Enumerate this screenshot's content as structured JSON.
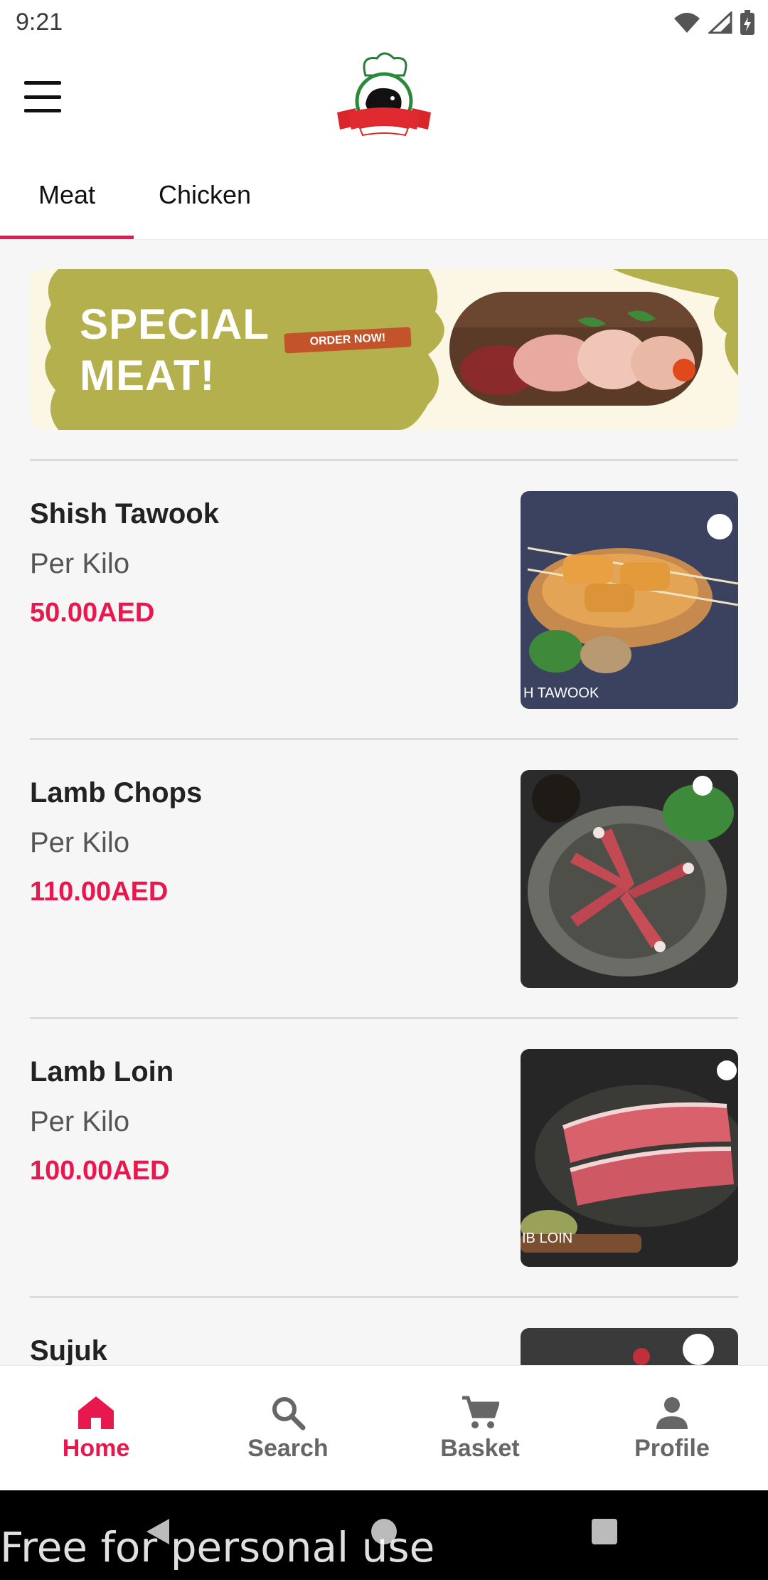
{
  "status_bar": {
    "time": "9:21"
  },
  "tabs": [
    {
      "label": "Meat",
      "active": true
    },
    {
      "label": "Chicken",
      "active": false
    }
  ],
  "banner": {
    "title_line1": "SPECIAL",
    "title_line2": "MEAT!",
    "cta": "ORDER NOW!"
  },
  "products": [
    {
      "name": "Shish Tawook",
      "unit": "Per Kilo",
      "price": "50.00AED",
      "image_caption": "H TAWOOK"
    },
    {
      "name": "Lamb Chops",
      "unit": "Per Kilo",
      "price": "110.00AED",
      "image_caption": ""
    },
    {
      "name": "Lamb Loin",
      "unit": "Per Kilo",
      "price": "100.00AED",
      "image_caption": "IB LOIN"
    },
    {
      "name": "Sujuk"
    }
  ],
  "bottom_nav": [
    {
      "label": "Home",
      "icon": "home-icon",
      "active": true
    },
    {
      "label": "Search",
      "icon": "search-icon",
      "active": false
    },
    {
      "label": "Basket",
      "icon": "cart-icon",
      "active": false
    },
    {
      "label": "Profile",
      "icon": "person-icon",
      "active": false
    }
  ],
  "watermark": "Free for personal use",
  "colors": {
    "accent": "#e8174e",
    "banner_olive": "#b5b04e",
    "text_dark": "#222222"
  }
}
